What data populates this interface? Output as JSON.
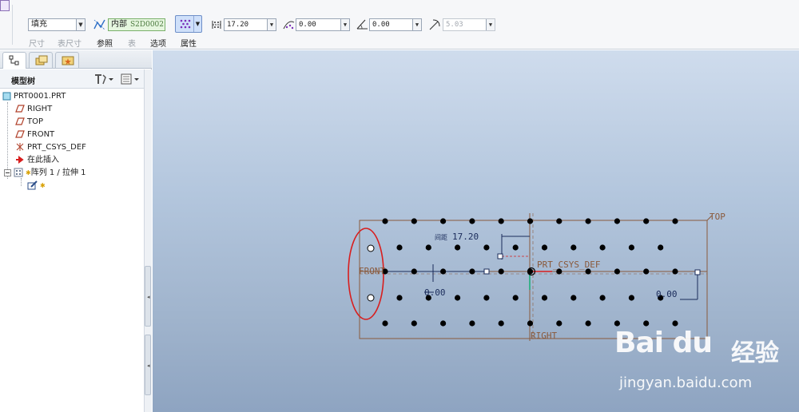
{
  "ribbon": {
    "fill_type": "填充",
    "ref_chip_label": "内部",
    "ref_chip_code": "S2D0002",
    "spacing_value": "17.20",
    "offset_value": "0.00",
    "angle_value": "0.00",
    "disabled_value": "5.03",
    "tabs": [
      "尺寸",
      "表尺寸",
      "参照",
      "表",
      "选项",
      "属性"
    ]
  },
  "left_panel": {
    "tree_title": "模型树",
    "nodes": [
      {
        "label": "PRT0001.PRT",
        "icon": "part-icon"
      },
      {
        "label": "RIGHT",
        "icon": "datum-plane-icon"
      },
      {
        "label": "TOP",
        "icon": "datum-plane-icon"
      },
      {
        "label": "FRONT",
        "icon": "datum-plane-icon"
      },
      {
        "label": "PRT_CSYS_DEF",
        "icon": "csys-icon"
      },
      {
        "label": "在此插入",
        "icon": "insert-here-arrow-icon"
      },
      {
        "label": "阵列 1 / 拉伸 1",
        "icon": "pattern-icon"
      },
      {
        "label": "",
        "icon": "sketch-edit-icon"
      }
    ]
  },
  "canvas": {
    "top_label": "TOP",
    "front_label": "FRONT",
    "right_label": "RIGHT",
    "csys_label": "PRT_CSYS_DEF",
    "dim_spacing_prefix": "间距",
    "dim_spacing": "17.20",
    "dim_offset_left": "0.00",
    "dim_offset_right": "0.00",
    "colors": {
      "sketch": "#8a5a3c",
      "dot": "#000000",
      "highlight": "#d81e1e"
    }
  },
  "watermark": {
    "logo": "Bai du",
    "cn": "经验",
    "url": "jingyan.baidu.com"
  }
}
